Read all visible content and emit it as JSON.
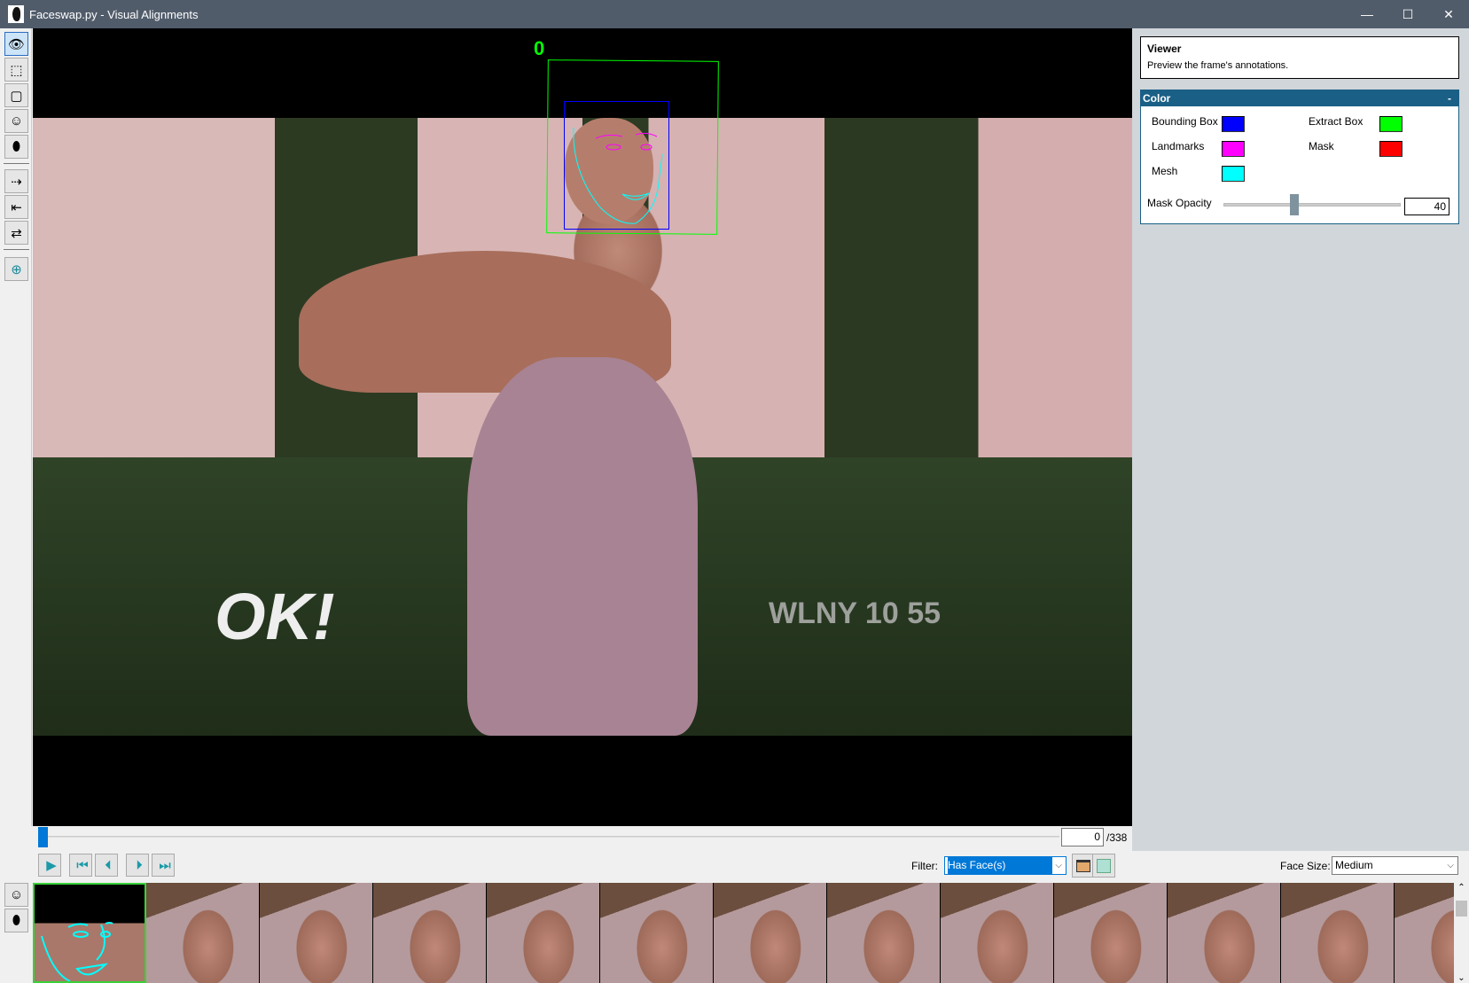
{
  "window": {
    "title": "Faceswap.py - Visual Alignments",
    "minimize": "—",
    "maximize": "☐",
    "close": "✕"
  },
  "toolbar": {
    "tools": [
      "view",
      "bounding-box",
      "extract-box",
      "landmarks",
      "mask"
    ],
    "actions": [
      "copy-prev",
      "copy-next",
      "reload"
    ],
    "zoom": "zoom"
  },
  "canvas": {
    "face_index": "0",
    "watermarks": {
      "ok": "OK!",
      "wlny": "WLNY 10 55"
    }
  },
  "viewer_info": {
    "title": "Viewer",
    "description": "Preview the frame's annotations."
  },
  "color_panel": {
    "title": "Color",
    "collapse": "-",
    "options": [
      {
        "label": "Bounding Box",
        "color": "#0000ff"
      },
      {
        "label": "Extract Box",
        "color": "#00ff00"
      },
      {
        "label": "Landmarks",
        "color": "#ff00ff"
      },
      {
        "label": "Mask",
        "color": "#ff0000"
      },
      {
        "label": "Mesh",
        "color": "#00ffff"
      }
    ],
    "mask_opacity": {
      "label": "Mask Opacity",
      "value": "40",
      "percent": 40
    }
  },
  "navigation": {
    "current_frame": "0",
    "total_frames": "/338",
    "progress": 0
  },
  "controls": {
    "play": "▶",
    "first": "⏮",
    "prev": "⏴",
    "next": "⏵",
    "last": "⏭",
    "filter_label": "Filter:",
    "filter_value": "Has Face(s)",
    "face_size_label": "Face Size:",
    "face_size_value": "Medium"
  },
  "colors": {
    "accent": "#0078d7",
    "panel_header": "#1a5f86",
    "titlebar": "#515c6b",
    "selected_thumb": "#3ad13a"
  }
}
